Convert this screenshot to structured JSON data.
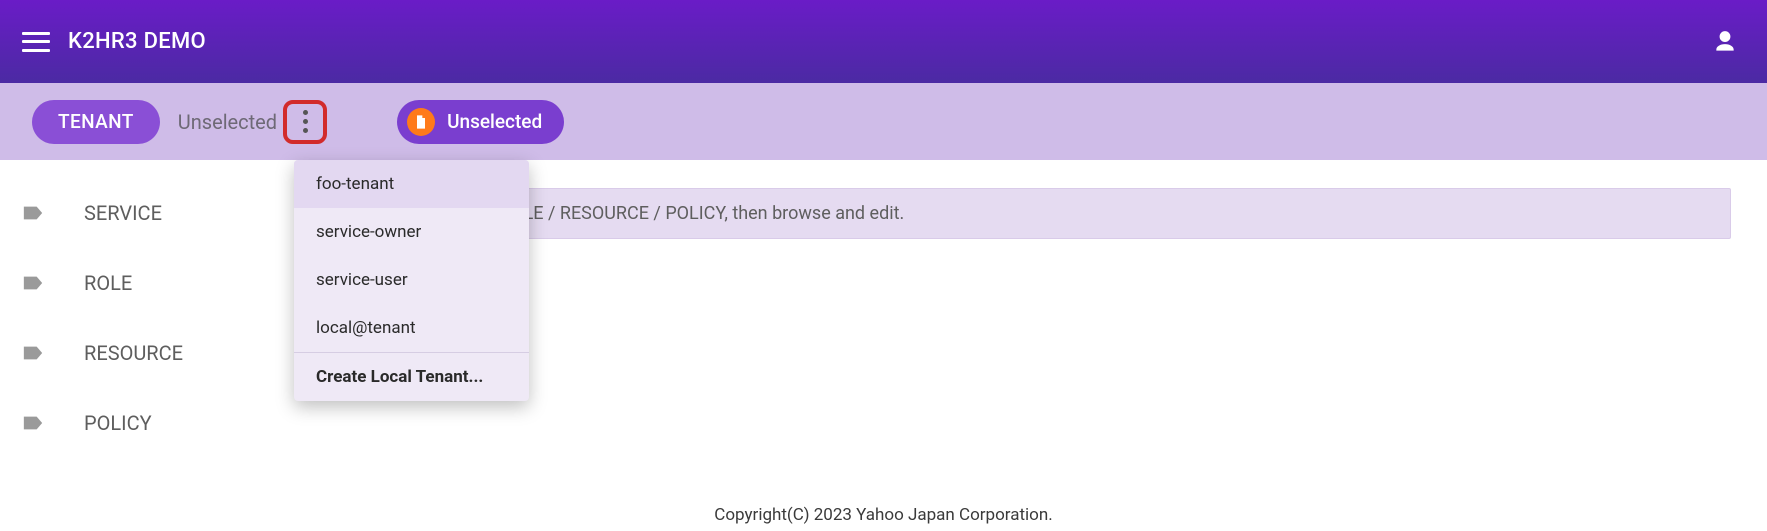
{
  "appbar": {
    "title": "K2HR3 DEMO"
  },
  "toolbar": {
    "tenant_chip_label": "TENANT",
    "tenant_status": "Unselected",
    "path_chip_label": "Unselected"
  },
  "sidebar": {
    "items": [
      {
        "label": "SERVICE"
      },
      {
        "label": "ROLE"
      },
      {
        "label": "RESOURCE"
      },
      {
        "label": "POLICY"
      }
    ]
  },
  "main": {
    "info_text": "the tenant, then select ROLE / RESOURCE / POLICY, then browse and edit."
  },
  "tenant_menu": {
    "items": [
      {
        "label": "foo-tenant"
      },
      {
        "label": "service-owner"
      },
      {
        "label": "service-user"
      },
      {
        "label": "local@tenant"
      }
    ],
    "create_label": "Create Local Tenant..."
  },
  "footer": {
    "text": "Copyright(C) 2023 Yahoo Japan Corporation."
  }
}
